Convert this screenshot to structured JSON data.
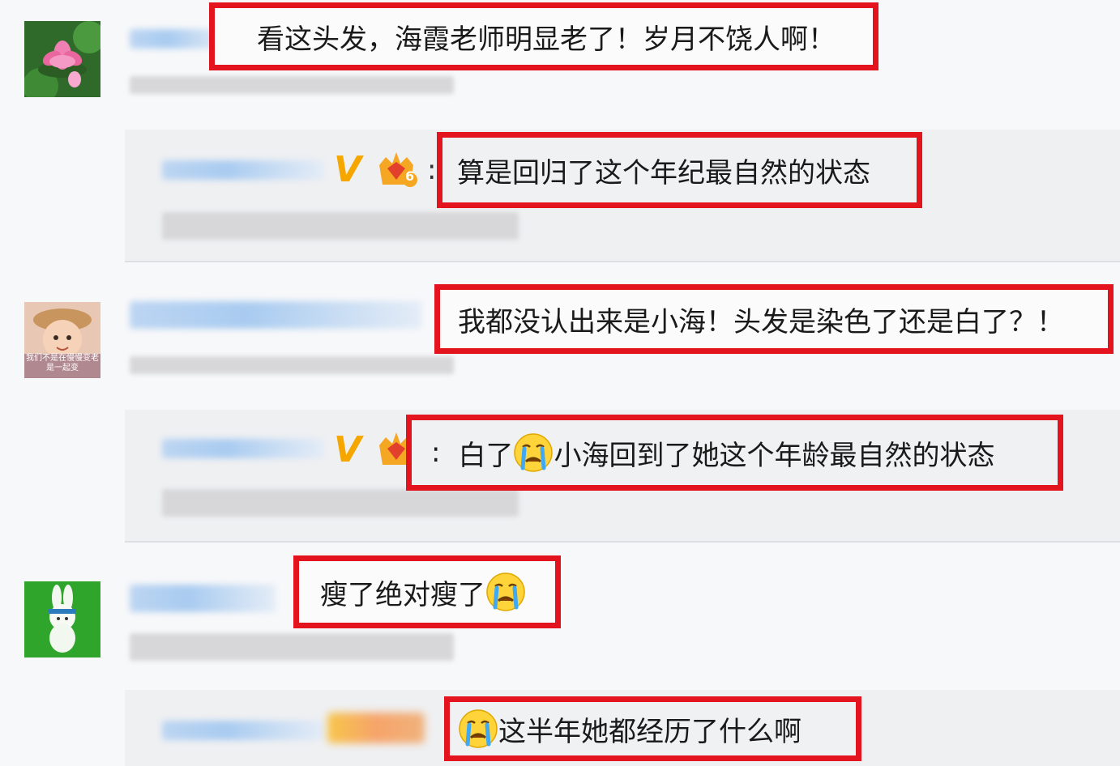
{
  "comments": [
    {
      "text": "看这头发，海霞老师明显老了！岁月不饶人啊！"
    },
    {
      "text": "算是回归了这个年纪最自然的状态",
      "prefix": ":"
    },
    {
      "text": "我都没认出来是小海！头发是染色了还是白了？！"
    },
    {
      "text_before": "白了",
      "text_after": "小海回到了她这个年龄最自然的状态",
      "prefix": ":"
    },
    {
      "text": "瘦了绝对瘦了"
    },
    {
      "text": "这半年她都经历了什么啊"
    }
  ],
  "badges": {
    "verified_letter": "V",
    "level": "6"
  },
  "avatar_caption": "我们不是在慢慢变老是一起变"
}
